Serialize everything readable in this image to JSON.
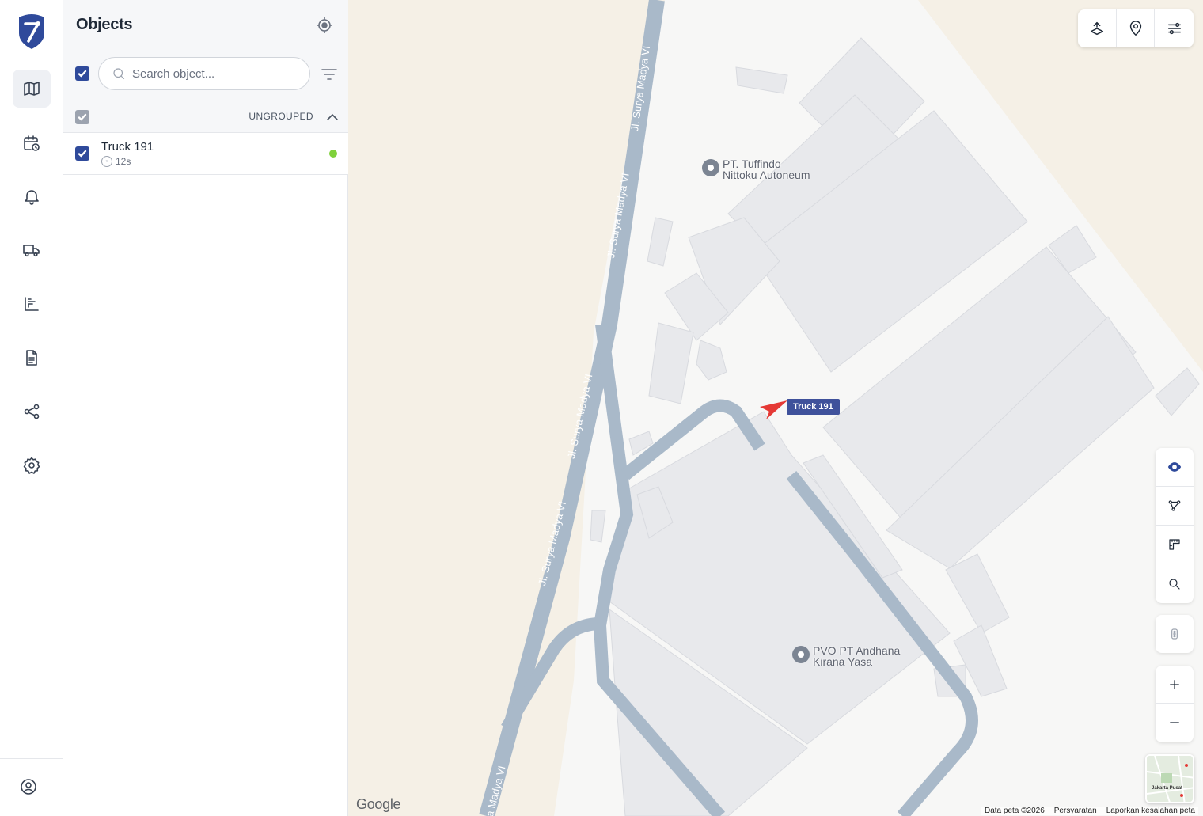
{
  "nav": {
    "items": [
      "map",
      "calendar-clock",
      "bell",
      "truck",
      "bar-chart",
      "document",
      "share",
      "settings"
    ],
    "active": "map",
    "footer_icon": "user-circle"
  },
  "panel": {
    "title": "Objects",
    "search_placeholder": "Search object...",
    "group": {
      "label": "UNGROUPED"
    },
    "objects": [
      {
        "name": "Truck 191",
        "last_update": "12s",
        "status_color": "#7fd13b"
      }
    ]
  },
  "map": {
    "streets": [
      "Jl. Surya Madya VI",
      "Jl. Surya Madya VI",
      "Jl. Surya Madya VI",
      "Jl. Surya Madya VI",
      "a Madya VI"
    ],
    "pois": [
      {
        "line1": "PT. Tuffindo",
        "line2": "Nittoku Autoneum"
      },
      {
        "line1": "PVO PT Andhana",
        "line2": "Kirana Yasa"
      }
    ],
    "vehicle_label": "Truck 191",
    "provider": "Google",
    "attribution": [
      "Data peta ©2026",
      "Persyaratan",
      "Laporkan kesalahan peta"
    ],
    "minimap_label": "Jakarta Pusat",
    "top_tools": [
      "route-icon",
      "pin-icon",
      "layers-toggle-icon"
    ],
    "side_tools": [
      "eye-icon",
      "polyline-icon",
      "ruler-icon",
      "search-icon"
    ],
    "colors": {
      "accent": "#2f4a9b",
      "vehicle": "#e53935",
      "road": "#a9b9c9"
    }
  }
}
